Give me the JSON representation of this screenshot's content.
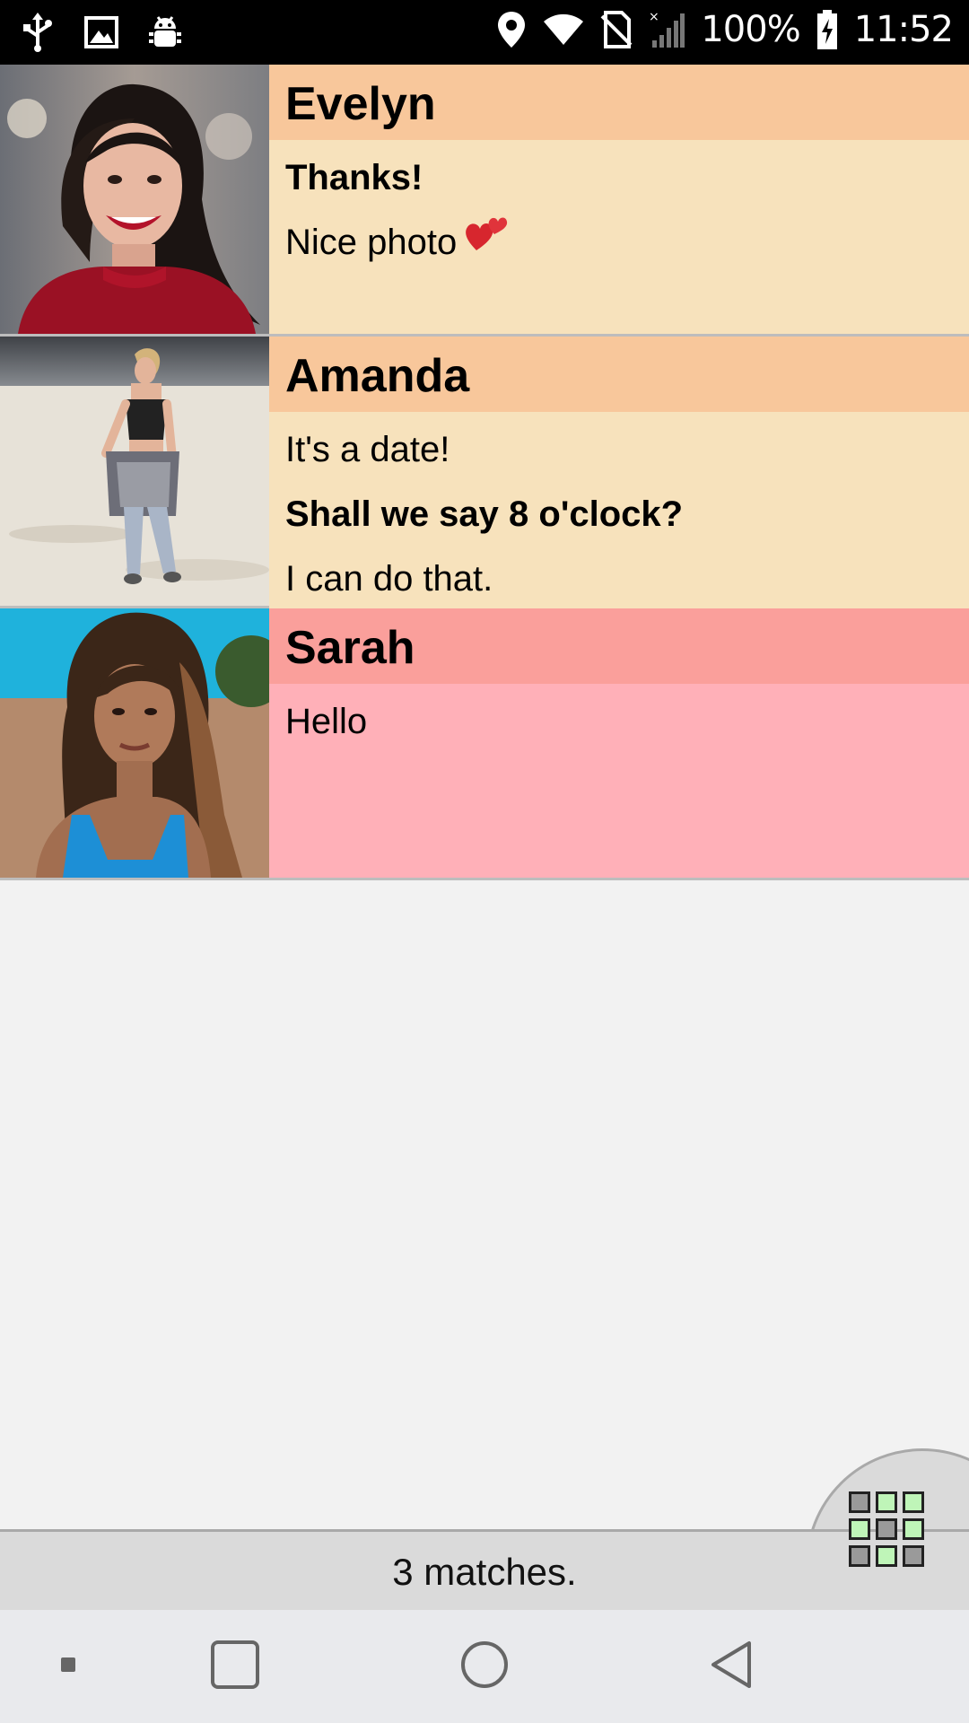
{
  "status_bar": {
    "battery": "100%",
    "time": "11:52",
    "left_icons": [
      "usb-icon",
      "image-icon",
      "android-debug-icon"
    ],
    "right_icons": [
      "location-icon",
      "wifi-icon",
      "no-sim-icon",
      "signal-icon",
      "battery-charging-icon"
    ]
  },
  "matches": [
    {
      "name": "Evelyn",
      "theme": "peach",
      "photo": "evelyn-photo",
      "messages": [
        {
          "text": "Thanks!",
          "bold": true
        },
        {
          "text": "Nice photo",
          "bold": false,
          "emoji": "two-hearts-icon"
        }
      ]
    },
    {
      "name": "Amanda",
      "theme": "peach",
      "photo": "amanda-photo",
      "messages": [
        {
          "text": "It's a date!",
          "bold": false
        },
        {
          "text": "Shall we say 8 o'clock?",
          "bold": true
        },
        {
          "text": "I can do that.",
          "bold": false
        }
      ]
    },
    {
      "name": "Sarah",
      "theme": "pink",
      "photo": "sarah-photo",
      "messages": [
        {
          "text": "Hello",
          "bold": false
        }
      ]
    }
  ],
  "footer": {
    "text": "3 matches.",
    "grid_button_icon": "grid-view-icon",
    "grid_pattern": [
      [
        "gray",
        "green",
        "green"
      ],
      [
        "green",
        "gray",
        "green"
      ],
      [
        "gray",
        "green",
        "gray"
      ]
    ]
  },
  "colors": {
    "peach_header": "#f8c79b",
    "peach_body": "#f7e2bc",
    "pink_header": "#fa9f9b",
    "pink_body": "#ffb0b8",
    "grid_green": "#bff5b8",
    "grid_gray": "#9a9a9a"
  },
  "nav_bar": {
    "buttons": [
      "screenshot-icon",
      "recent-apps-icon",
      "home-icon",
      "back-icon"
    ]
  }
}
